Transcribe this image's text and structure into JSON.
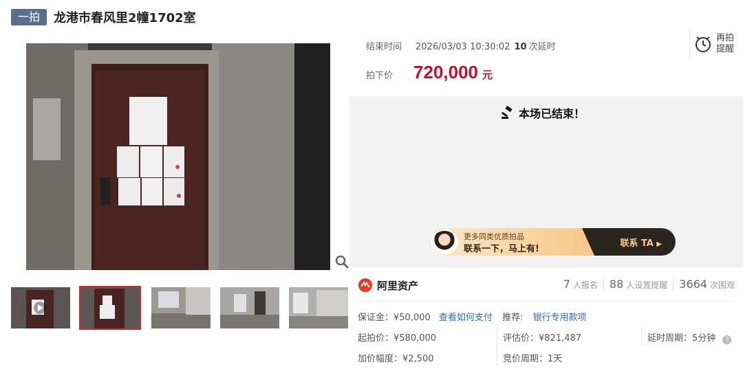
{
  "header": {
    "badge": "一拍",
    "title": "龙港市春风里2幢1702室"
  },
  "auction": {
    "end_time_label": "结束时间",
    "end_time_value": "2026/03/03 10:30:02",
    "delay_count": "10",
    "delay_label": "次延时",
    "price_label": "拍下价",
    "price_value": "720,000",
    "price_unit": "元",
    "remind_line1": "再拍",
    "remind_line2": "提醒",
    "ended_message": "本场已结束！"
  },
  "banner": {
    "line1": "更多同类优质拍品",
    "line2": "联系一下，马上有!",
    "cta": "联系 TA"
  },
  "platform": {
    "name": "阿里资产"
  },
  "stats": {
    "signups": "7",
    "signups_label": "人报名",
    "reminders": "88",
    "reminders_label": "人设置提醒",
    "views": "3664",
    "views_label": "次围观"
  },
  "details": {
    "deposit": "保证金：¥50,000",
    "how_to_pay": "查看如何支付",
    "recommend_label": "推荐:",
    "recommend_link": "银行专用款项",
    "start_price": "起拍价：¥580,000",
    "appraisal": "评估价：¥821,487",
    "delay_period": "延时周期：5分钟",
    "increment": "加价幅度：¥2,500",
    "bid_period": "竞价周期：1天"
  },
  "colors": {
    "price_red": "#c8102e",
    "badge_blue": "#5a6f8f",
    "link_blue": "#2a6bd1"
  }
}
